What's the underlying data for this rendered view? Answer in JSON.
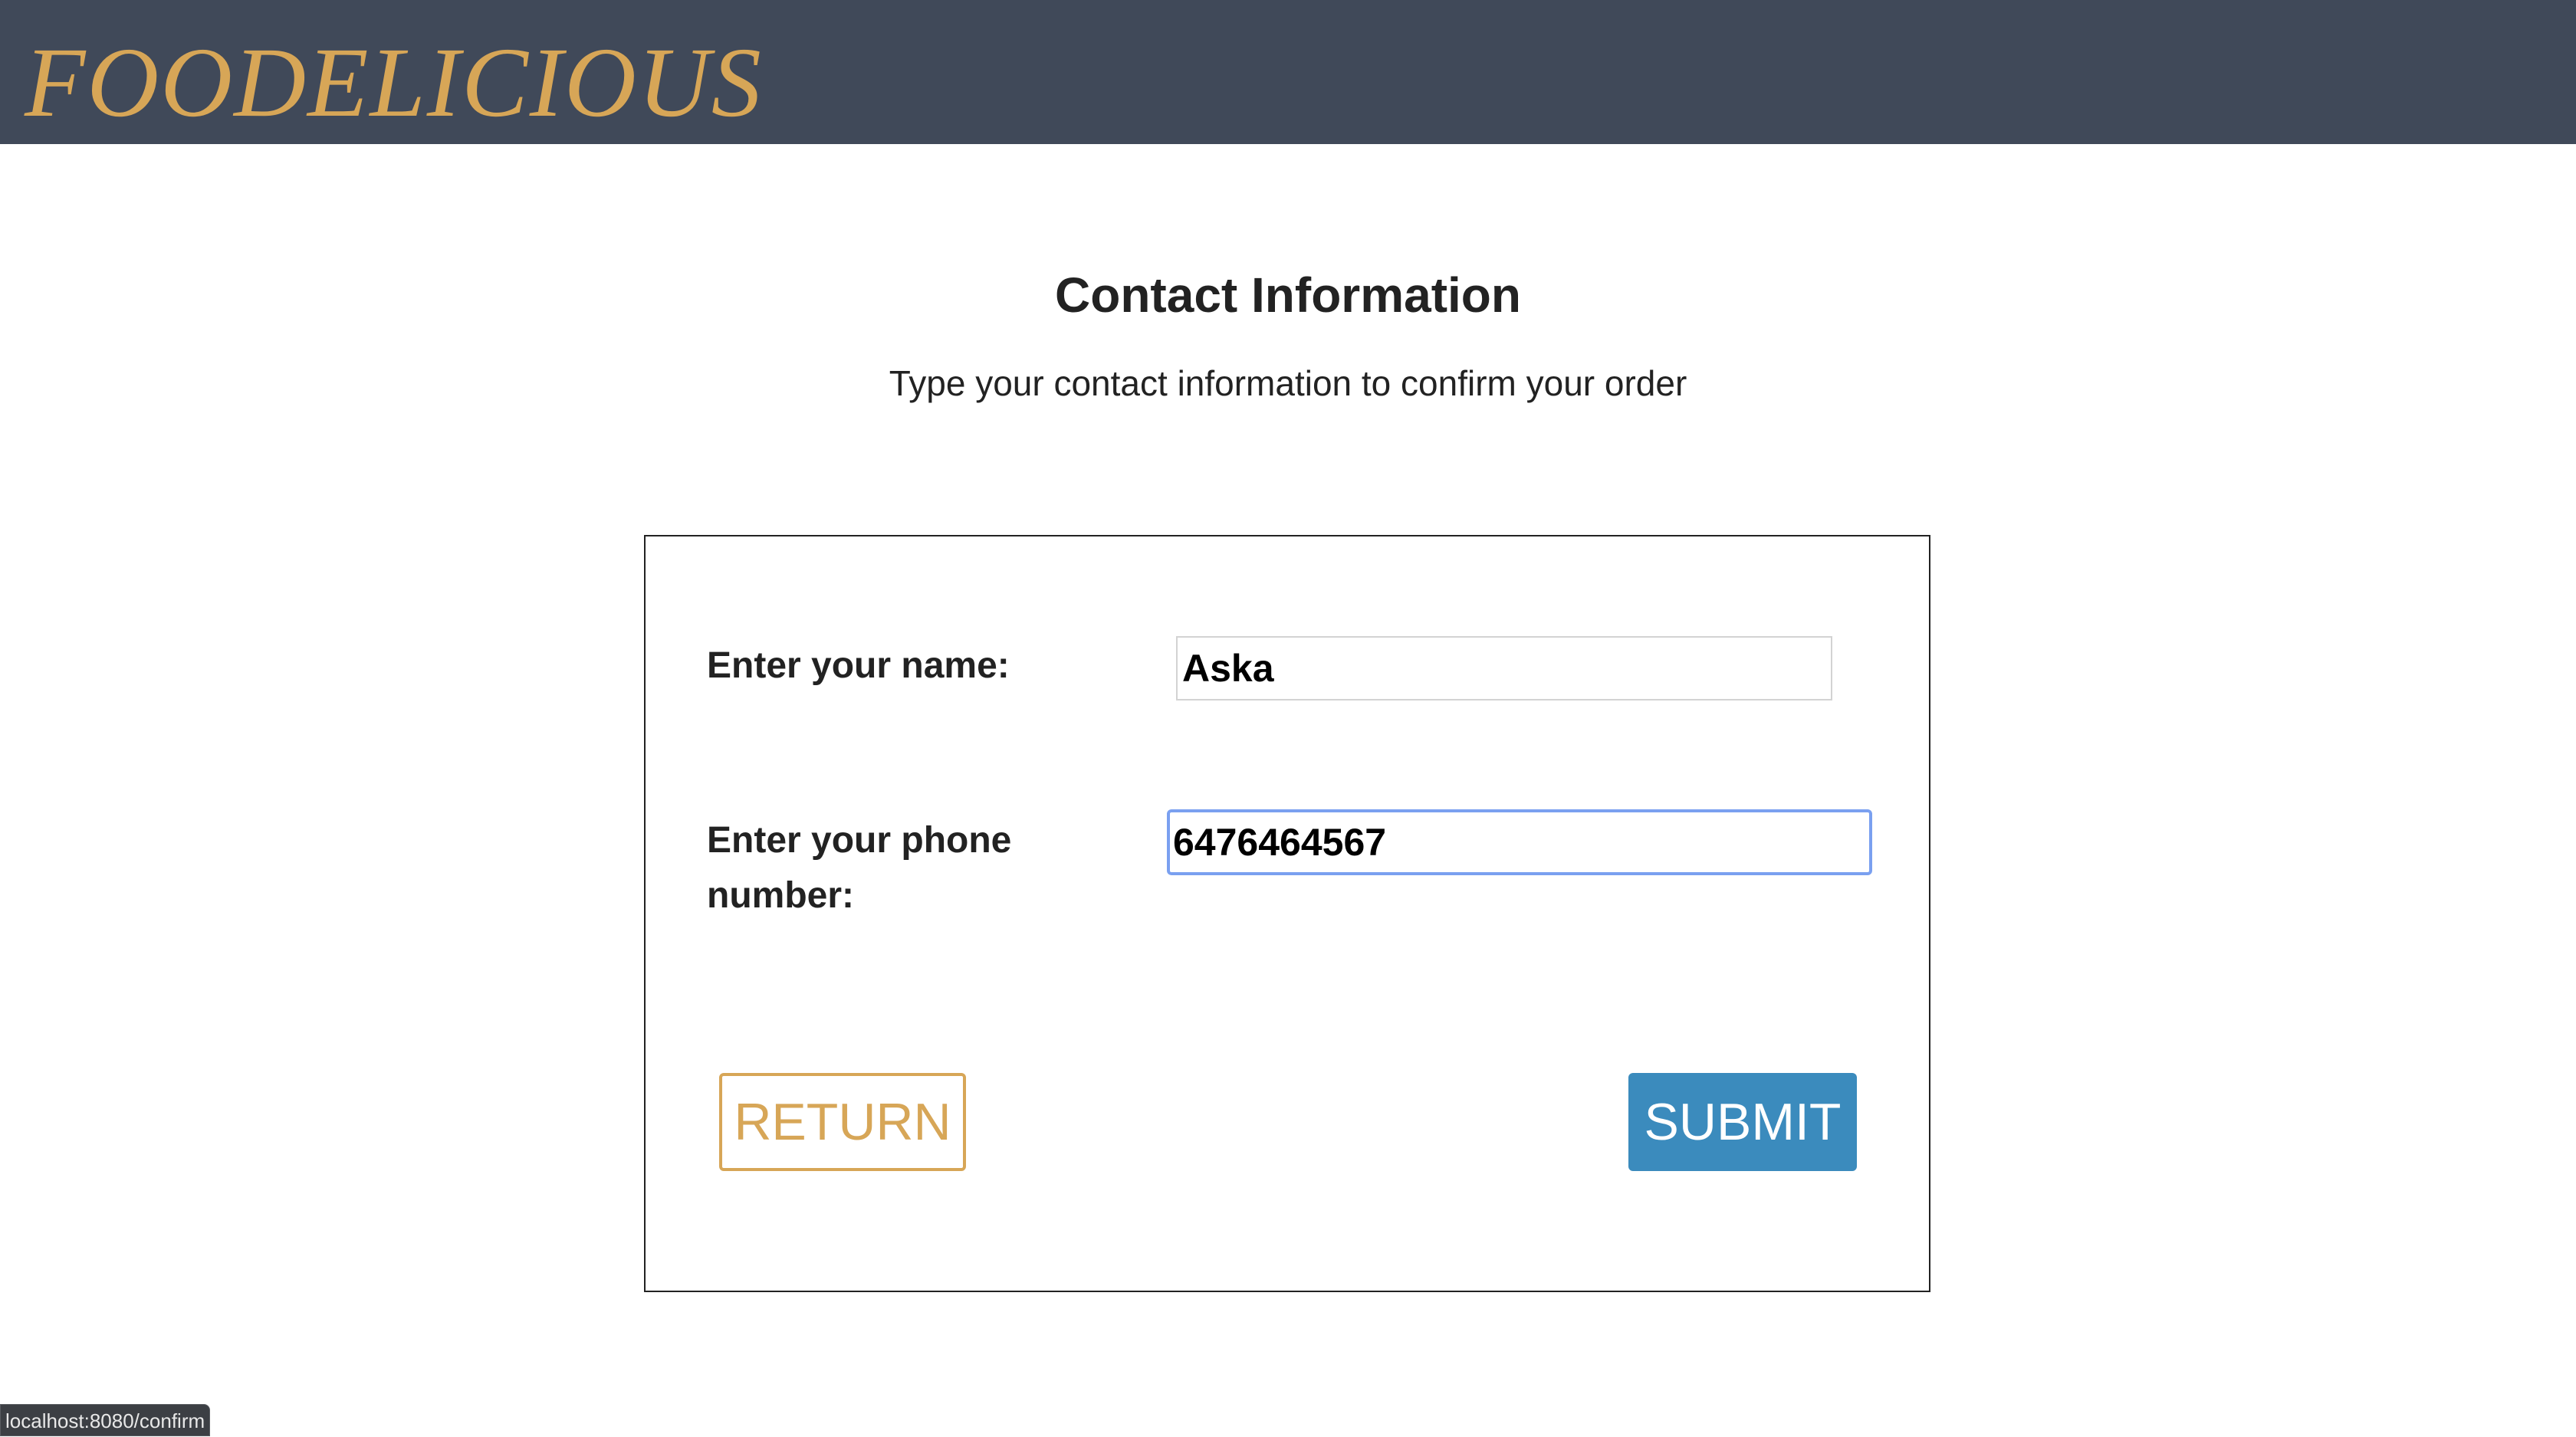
{
  "header": {
    "brand": "FOODELICIOUS"
  },
  "main": {
    "title": "Contact Information",
    "subtitle": "Type your contact information to confirm your order"
  },
  "form": {
    "name_label": "Enter your name:",
    "name_value": "Aska",
    "phone_label": "Enter your phone number:",
    "phone_value": "6476464567",
    "return_label": "RETURN",
    "submit_label": "SUBMIT"
  },
  "status_bar": {
    "url": "localhost:8080/confirm"
  },
  "colors": {
    "header_bg": "#404959",
    "brand": "#d7a657",
    "submit_bg": "#3b8bbd",
    "focus_ring": "#7aa0f0"
  }
}
